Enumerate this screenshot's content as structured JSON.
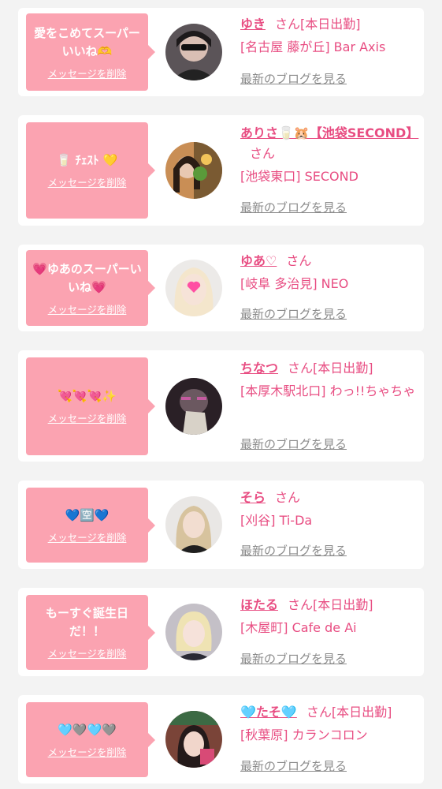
{
  "cards": [
    {
      "message": "愛をこめてスーパーいいね🫶",
      "delete_label": "メッセージを削除",
      "name": "ゆき",
      "honorific": "さん",
      "status": "[本日出勤]",
      "shop": "[名古屋 藤が丘] Bar Axis",
      "blog_label": "最新のブログを見る"
    },
    {
      "message": "🥛 ﾁｪｽﾄ 💛",
      "delete_label": "メッセージを削除",
      "name": "ありさ🥛🐹【池袋SECOND】",
      "honorific": "さん",
      "status": "",
      "shop": "[池袋東口] SECOND",
      "blog_label": "最新のブログを見る"
    },
    {
      "message": "💗ゆあのスーパーいいね💗",
      "delete_label": "メッセージを削除",
      "name": "ゆあ♡",
      "honorific": "さん",
      "status": "",
      "shop": "[岐阜 多治見] NEO",
      "blog_label": "最新のブログを見る"
    },
    {
      "message": "💘💘💘✨",
      "delete_label": "メッセージを削除",
      "name": "ちなつ",
      "honorific": "さん",
      "status": "[本日出勤]",
      "shop": "[本厚木駅北口] わっ!!ちゃちゃ",
      "blog_label": "最新のブログを見る"
    },
    {
      "message": "💙🈳💙",
      "delete_label": "メッセージを削除",
      "name": "そら",
      "honorific": "さん",
      "status": "",
      "shop": "[刈谷] Ti-Da",
      "blog_label": "最新のブログを見る"
    },
    {
      "message": "もーすぐ誕生日だ！！",
      "delete_label": "メッセージを削除",
      "name": "ほたる",
      "honorific": "さん",
      "status": "[本日出勤]",
      "shop": "[木屋町] Cafe de Ai",
      "blog_label": "最新のブログを見る"
    },
    {
      "message": "🩵🩶🩵🩶",
      "delete_label": "メッセージを削除",
      "name": "🩵たそ🩵",
      "honorific": "さん",
      "status": "[本日出勤]",
      "shop": "[秋葉原] カランコロン",
      "blog_label": "最新のブログを見る"
    }
  ]
}
